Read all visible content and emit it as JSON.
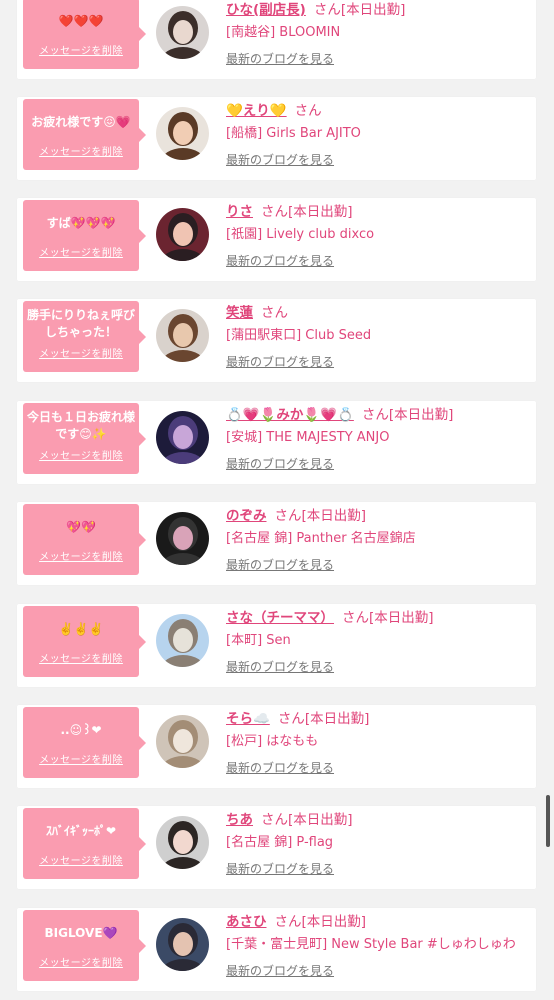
{
  "colors": {
    "background": "#f2f2f2",
    "bubble": "#fa9cb0",
    "accent": "#e0467b",
    "link_grey": "#777777"
  },
  "common": {
    "delete_label": "メッセージを削除",
    "san": "さん",
    "blog_label": "最新のブログを見る"
  },
  "cards": [
    {
      "message": "❤️❤️❤️",
      "name": "ひな(副店長)",
      "badge": "[本日出勤]",
      "shop": "[南越谷] BLOOMIN"
    },
    {
      "message": "お疲れ様です😖💗",
      "name": "💛えり💛",
      "badge": "",
      "shop": "[船橋] Girls Bar AJITO"
    },
    {
      "message": "すば💖💖💖",
      "name": "りさ",
      "badge": "[本日出勤]",
      "shop": "[祇園] Lively club dixco"
    },
    {
      "message": "勝手にりりねぇ呼びしちゃった！",
      "name": "笑蓮",
      "badge": "",
      "shop": "[蒲田駅東口] Club Seed"
    },
    {
      "message": "今日も１日お疲れ様です😊✨",
      "name": "💍💗🌷みか🌷💗💍",
      "badge": "[本日出勤]",
      "shop": "[安城] THE MAJESTY ANJO"
    },
    {
      "message": "💖💖",
      "name": "のぞみ",
      "badge": "[本日出勤]",
      "shop": "[名古屋 錦] Panther 名古屋錦店"
    },
    {
      "message": "✌️✌️✌️",
      "name": "さな（チーママ）",
      "badge": "[本日出勤]",
      "shop": "[本町] Sen"
    },
    {
      "message": "..☺︎꒱❤︎",
      "name": "そら☁️",
      "badge": "[本日出勤]",
      "shop": "[松戸] はなもも"
    },
    {
      "message": "ｽﾊﾞｲｷﾞｯｰﾎﾟ❤︎",
      "name": "ちあ",
      "badge": "[本日出勤]",
      "shop": "[名古屋 錦] P-flag"
    },
    {
      "message": "BIGLOVE💜",
      "name": "あさひ",
      "badge": "[本日出勤]",
      "shop": "[千葉・富士見町] New Style Bar #しゅわしゅわ"
    }
  ]
}
